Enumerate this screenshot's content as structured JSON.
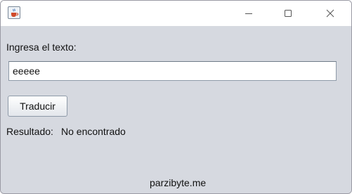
{
  "window": {
    "app_icon": "java-coffee-icon",
    "controls": {
      "minimize_icon": "minimize-icon",
      "maximize_icon": "maximize-icon",
      "close_icon": "close-icon"
    }
  },
  "form": {
    "prompt_label": "Ingresa el texto:",
    "input_value": "eeeee",
    "translate_button": "Traducir",
    "result_label": "Resultado:",
    "result_value": "No encontrado"
  },
  "footer": {
    "credit": "parzibyte.me"
  },
  "colors": {
    "window_background": "#d6d9e0",
    "titlebar_background": "#ffffff",
    "field_background": "#ffffff",
    "text": "#111111"
  }
}
